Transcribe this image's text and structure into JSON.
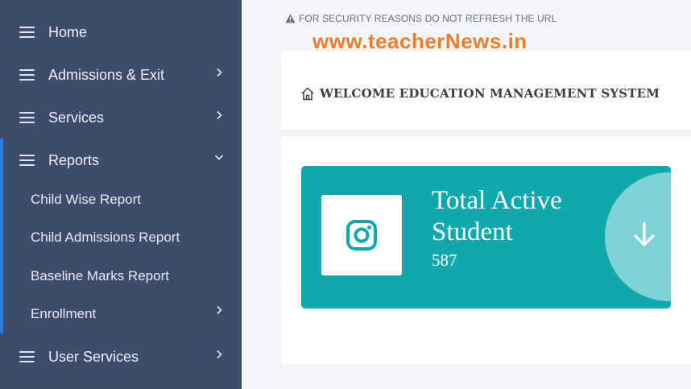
{
  "sidebar": {
    "items": [
      {
        "label": "Home"
      },
      {
        "label": "Admissions & Exit"
      },
      {
        "label": "Services"
      },
      {
        "label": "Reports"
      },
      {
        "label": "User Services"
      }
    ],
    "reports_sub": [
      {
        "label": "Child Wise Report"
      },
      {
        "label": "Child Admissions Report"
      },
      {
        "label": "Baseline Marks Report"
      },
      {
        "label": "Enrollment"
      }
    ]
  },
  "notice": {
    "text": "FOR SECURITY REASONS DO NOT REFRESH THE URL",
    "icon": "warning-icon"
  },
  "watermark": {
    "text": "www.teacherNews.in"
  },
  "welcome": {
    "title": "WELCOME EDUCATION MANAGEMENT SYSTEM",
    "icon": "home-icon"
  },
  "stat": {
    "title": "Total Active Student",
    "value": "587",
    "icon": "instagram-icon",
    "action_icon": "arrow-down-icon"
  },
  "colors": {
    "sidebar_bg": "#3d4c6b",
    "active_indicator": "#2a7de1",
    "stat_card_bg": "#0fa8ad",
    "stat_circle": "#7fd2d5",
    "watermark": "#ef7d2a",
    "page_bg": "#f4f5f8"
  }
}
